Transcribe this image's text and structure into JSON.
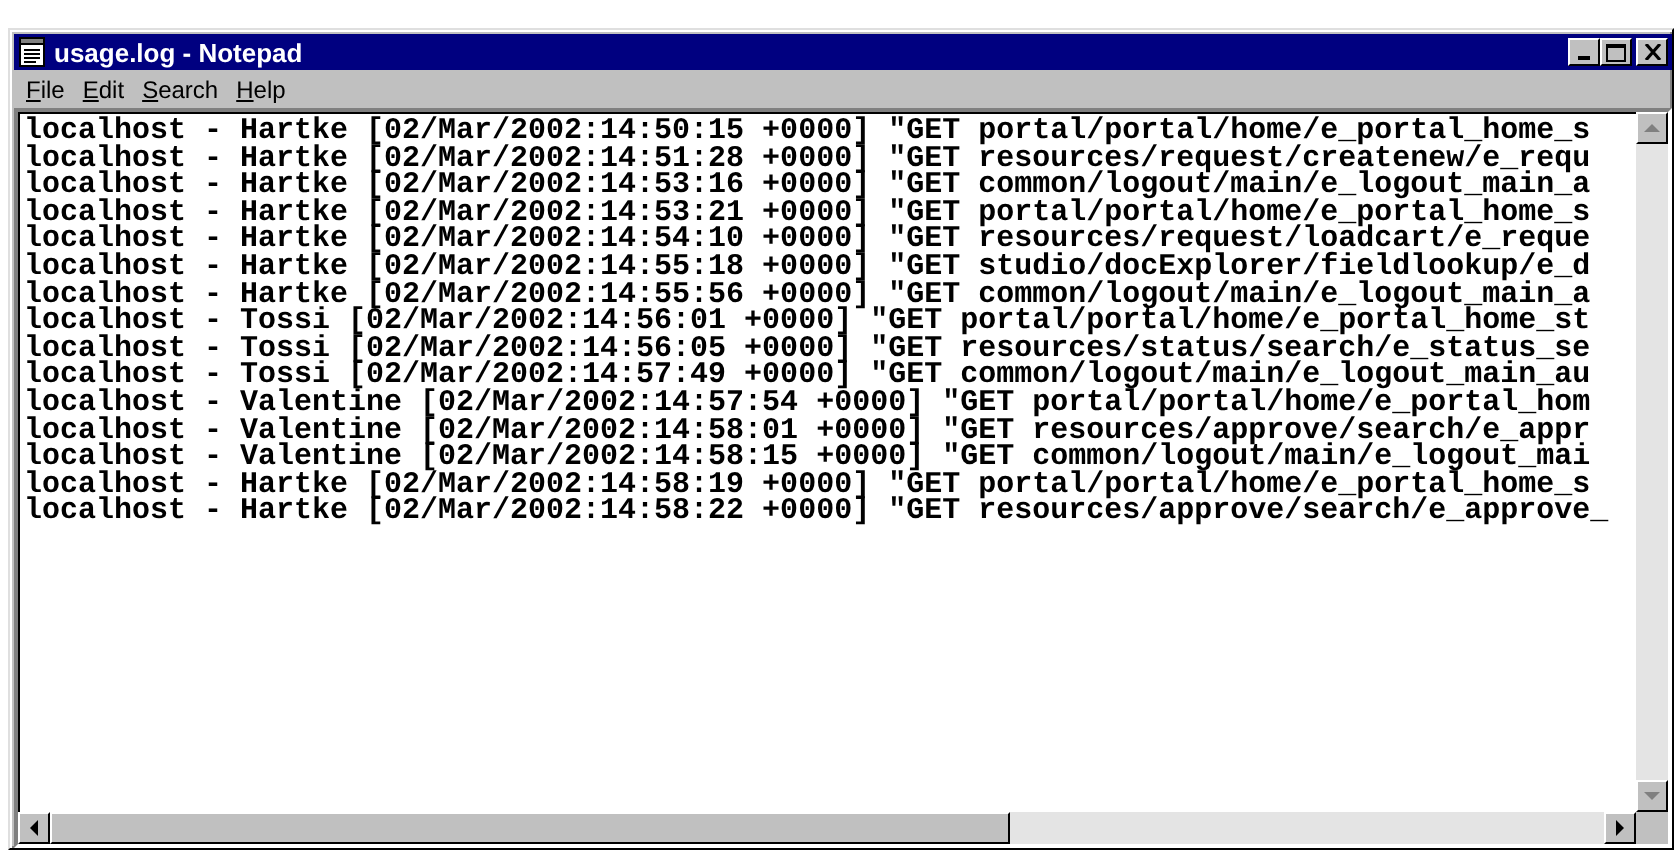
{
  "window": {
    "title": "usage.log - Notepad"
  },
  "menu": [
    {
      "label": "File"
    },
    {
      "label": "Edit"
    },
    {
      "label": "Search"
    },
    {
      "label": "Help"
    }
  ],
  "lines": [
    "localhost - Hartke [02/Mar/2002:14:50:15 +0000] \"GET portal/portal/home/e_portal_home_s",
    "localhost - Hartke [02/Mar/2002:14:51:28 +0000] \"GET resources/request/createnew/e_requ",
    "localhost - Hartke [02/Mar/2002:14:53:16 +0000] \"GET common/logout/main/e_logout_main_a",
    "localhost - Hartke [02/Mar/2002:14:53:21 +0000] \"GET portal/portal/home/e_portal_home_s",
    "localhost - Hartke [02/Mar/2002:14:54:10 +0000] \"GET resources/request/loadcart/e_reque",
    "localhost - Hartke [02/Mar/2002:14:55:18 +0000] \"GET studio/docExplorer/fieldlookup/e_d",
    "localhost - Hartke [02/Mar/2002:14:55:56 +0000] \"GET common/logout/main/e_logout_main_a",
    "localhost - Tossi [02/Mar/2002:14:56:01 +0000] \"GET portal/portal/home/e_portal_home_st",
    "localhost - Tossi [02/Mar/2002:14:56:05 +0000] \"GET resources/status/search/e_status_se",
    "localhost - Tossi [02/Mar/2002:14:57:49 +0000] \"GET common/logout/main/e_logout_main_au",
    "localhost - Valentine [02/Mar/2002:14:57:54 +0000] \"GET portal/portal/home/e_portal_hom",
    "localhost - Valentine [02/Mar/2002:14:58:01 +0000] \"GET resources/approve/search/e_appr",
    "localhost - Valentine [02/Mar/2002:14:58:15 +0000] \"GET common/logout/main/e_logout_mai",
    "localhost - Hartke [02/Mar/2002:14:58:19 +0000] \"GET portal/portal/home/e_portal_home_s",
    "localhost - Hartke [02/Mar/2002:14:58:22 +0000] \"GET resources/approve/search/e_approve_"
  ]
}
